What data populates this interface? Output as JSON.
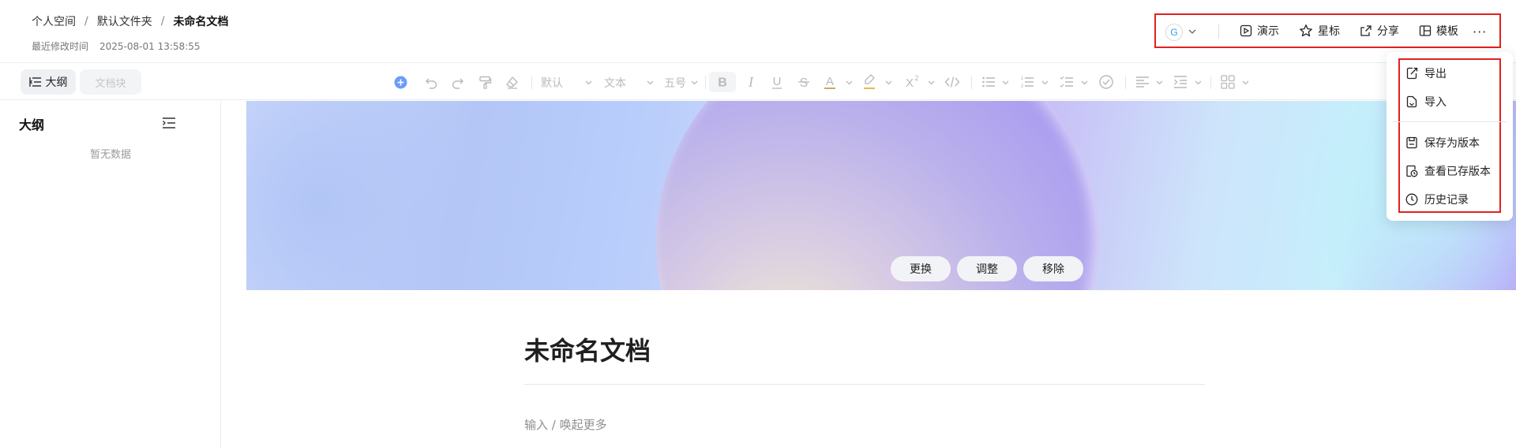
{
  "breadcrumb": {
    "root": "个人空间",
    "folder": "默认文件夹",
    "current": "未命名文档",
    "separator": "/"
  },
  "modified": {
    "label": "最近修改时间",
    "time": "2025-08-01 13:58:55"
  },
  "top_actions": {
    "avatar_letter": "G",
    "present": "演示",
    "star": "星标",
    "share": "分享",
    "template": "模板",
    "more": "···"
  },
  "toolbar": {
    "outline_tab": "大纲",
    "docblock_tab": "文档块",
    "font": "默认",
    "block_type": "文本",
    "size": "五号"
  },
  "sidebar": {
    "title": "大纲",
    "empty": "暂无数据"
  },
  "cover": {
    "replace": "更换",
    "adjust": "调整",
    "remove": "移除"
  },
  "doc": {
    "title": "未命名文档",
    "hint": "输入 / 唤起更多"
  },
  "menu": {
    "export": "导出",
    "import": "导入",
    "save_version": "保存为版本",
    "view_versions": "查看已存版本",
    "history": "历史记录"
  },
  "colors": {
    "highlight_border": "#e0211f",
    "accent": "#4c8dff"
  }
}
